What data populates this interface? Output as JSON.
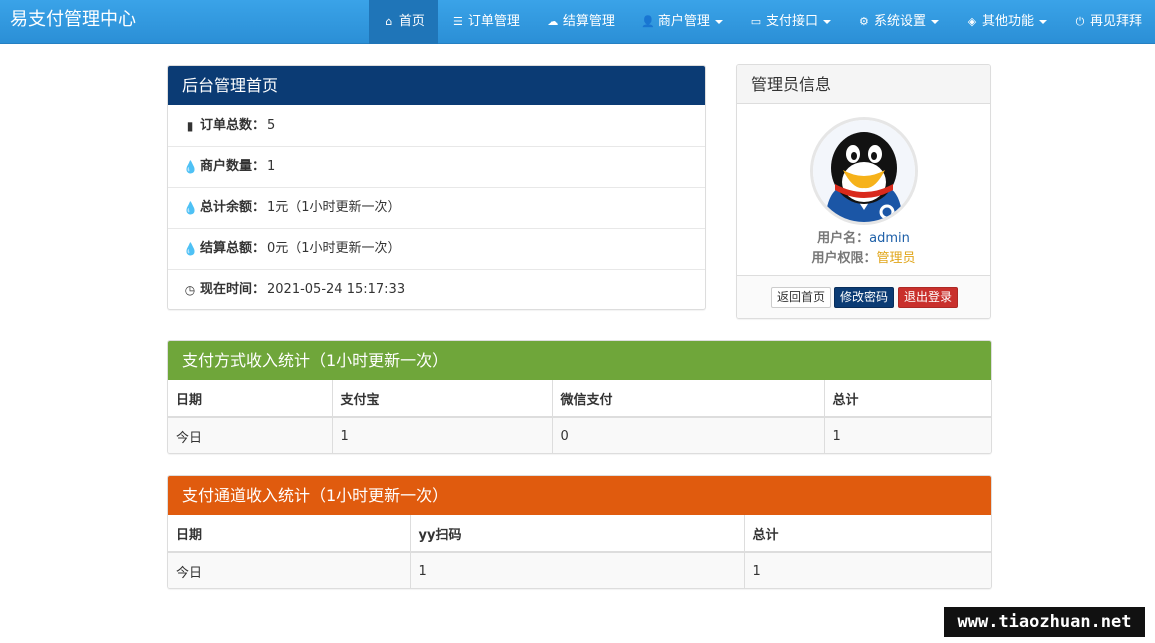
{
  "app": {
    "brand": "易支付管理中心"
  },
  "nav": [
    {
      "label": "首页",
      "icon": "home-icon",
      "glyph": "⌂",
      "active": true,
      "dropdown": false
    },
    {
      "label": "订单管理",
      "icon": "list-icon",
      "glyph": "☰",
      "active": false,
      "dropdown": false
    },
    {
      "label": "结算管理",
      "icon": "cloud-icon",
      "glyph": "☁",
      "active": false,
      "dropdown": false
    },
    {
      "label": "商户管理",
      "icon": "user-icon",
      "glyph": "👤",
      "active": false,
      "dropdown": true
    },
    {
      "label": "支付接口",
      "icon": "credit-card-icon",
      "glyph": "▭",
      "active": false,
      "dropdown": true
    },
    {
      "label": "系统设置",
      "icon": "gear-icon",
      "glyph": "⚙",
      "active": false,
      "dropdown": true
    },
    {
      "label": "其他功能",
      "icon": "box-icon",
      "glyph": "◈",
      "active": false,
      "dropdown": true
    },
    {
      "label": "再见拜拜",
      "icon": "power-icon",
      "glyph": "⏻",
      "active": false,
      "dropdown": false
    }
  ],
  "overview": {
    "title": "后台管理首页",
    "rows": [
      {
        "icon": "bar-chart-icon",
        "glyph": "▮",
        "label": "订单总数：",
        "value": "5"
      },
      {
        "icon": "tint-icon",
        "glyph": "💧",
        "label": "商户数量：",
        "value": "1"
      },
      {
        "icon": "tint-icon",
        "glyph": "💧",
        "label": "总计余额：",
        "value": "1元（1小时更新一次）"
      },
      {
        "icon": "tint-icon",
        "glyph": "💧",
        "label": "结算总额：",
        "value": "0元（1小时更新一次）"
      },
      {
        "icon": "clock-icon",
        "glyph": "◷",
        "label": "现在时间：",
        "value": " 2021-05-24 15:17:33"
      }
    ]
  },
  "admin": {
    "title": "管理员信息",
    "username_label": "用户名：",
    "username": "admin",
    "role_label": "用户权限：",
    "role": "管理员",
    "buttons": {
      "home": "返回首页",
      "change_password": "修改密码",
      "logout": "退出登录"
    }
  },
  "pay_method_stats": {
    "title": "支付方式收入统计（1小时更新一次）",
    "headers": [
      "日期",
      "支付宝",
      "微信支付",
      "总计"
    ],
    "rows": [
      [
        "今日",
        "1",
        "0",
        "1"
      ]
    ]
  },
  "channel_stats": {
    "title": "支付通道收入统计（1小时更新一次）",
    "headers": [
      "日期",
      "yy扫码",
      "总计"
    ],
    "rows": [
      [
        "今日",
        "1",
        "1"
      ]
    ]
  },
  "watermark": "www.tiaozhuan.net",
  "colors": {
    "navbar": "#2b8fd6",
    "dark_heading": "#0b3b74",
    "green_heading": "#6fa63a",
    "orange_heading": "#e05b0e"
  }
}
